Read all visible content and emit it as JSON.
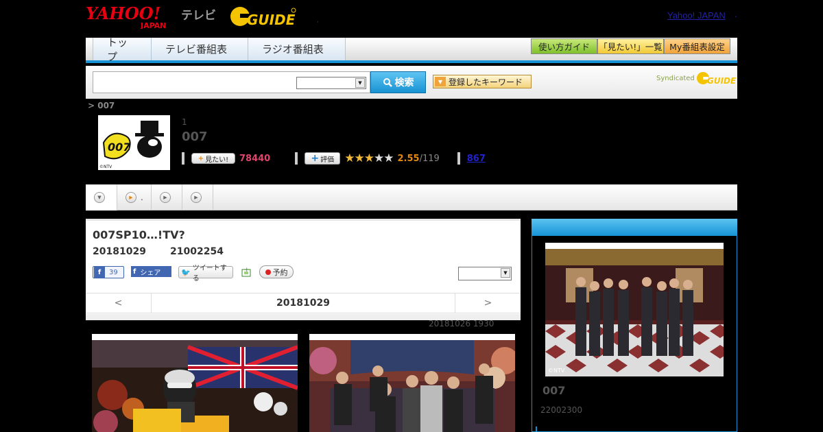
{
  "header": {
    "yahoo_logo": "YAHOO! JAPAN",
    "tv_label": "テレビ",
    "gguide_logo": "G-GUIDE",
    "yahoo_japan_link": "Yahoo! JAPAN",
    "dot_sep": ".",
    "small_sep": ","
  },
  "nav": {
    "tabs": [
      "トップ",
      "テレビ番組表",
      "ラジオ番組表"
    ],
    "buttons": [
      "使い方ガイド",
      "「見たい!」一覧",
      "My番組表設定"
    ]
  },
  "search": {
    "button_label": "検索",
    "keyword_button": "登録したキーワード",
    "syndicated_label": "Syndicated"
  },
  "program": {
    "breadcrumb": "> 007",
    "thumb_caption": "©NTV",
    "number": "1",
    "title": "007",
    "mitai_button": "見たい!",
    "mitai_count": "78440",
    "hyoka_button": "評価",
    "rating_value": "2.55",
    "rating_count": "/119",
    "review_count": "867",
    "stars": [
      1,
      1,
      0.5,
      0,
      0
    ]
  },
  "subtabs": [
    {
      "label": ""
    },
    {
      "label": "."
    },
    {
      "label": ""
    },
    {
      "label": ""
    }
  ],
  "episode": {
    "title": "007SP10…!TV?",
    "date": "20181029",
    "id": "21002254",
    "fb_like_count": "39",
    "fb_share_label": "シェア",
    "tweet_label": "ツイートする",
    "reserve_label": "予約",
    "pager_prev": "<",
    "pager_date": "20181029",
    "pager_next": ">",
    "update_note": "20181026  1930"
  },
  "side": {
    "img_caption": "©NTV",
    "title": "007",
    "id": "22002300"
  },
  "colors": {
    "accent_blue": "#1693d6",
    "mitai_pink": "#e0446a",
    "rating_orange": "#e48a12"
  }
}
